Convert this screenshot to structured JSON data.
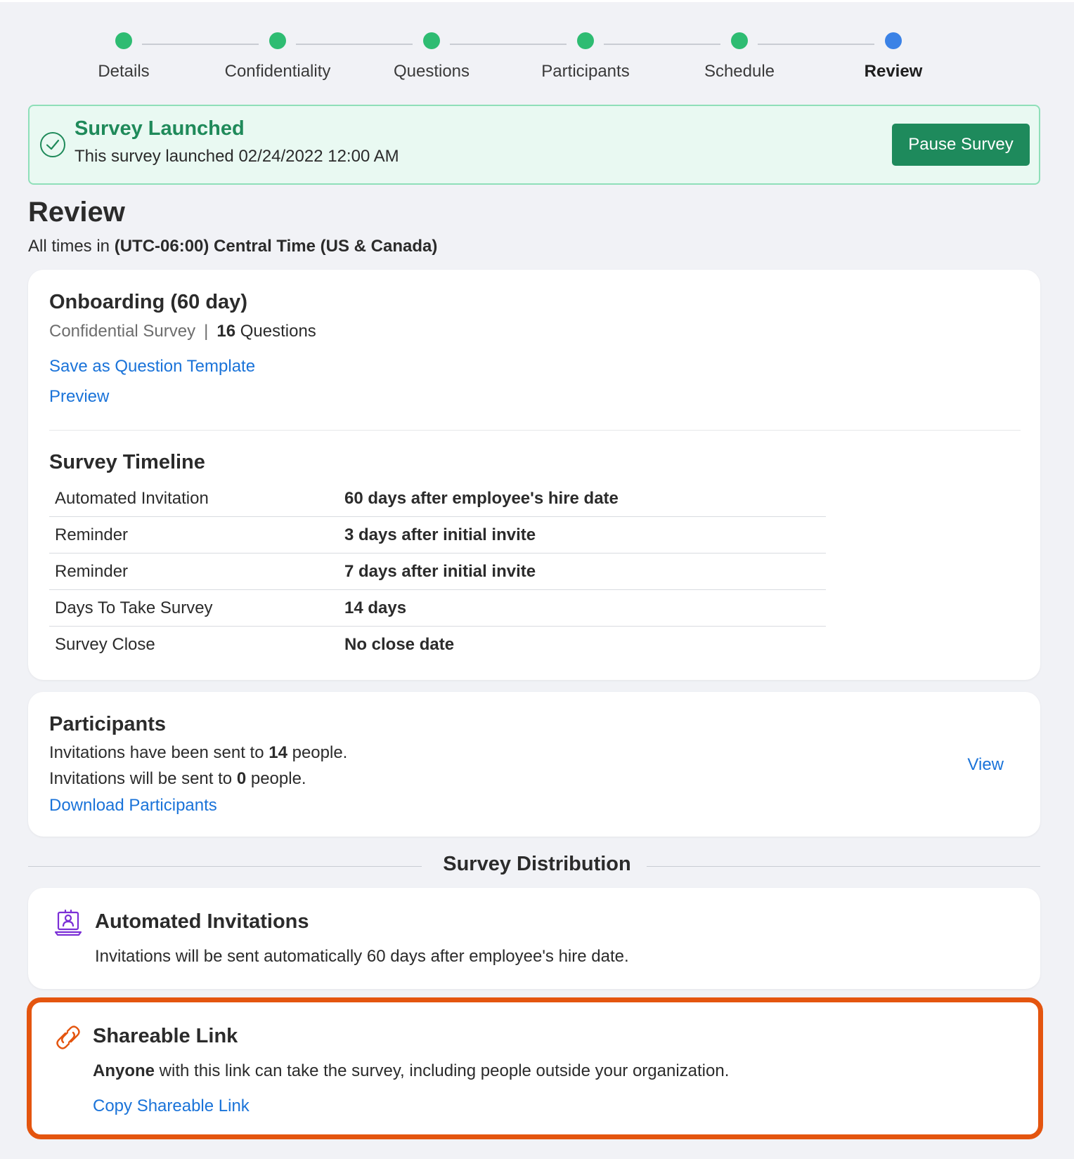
{
  "stepper": {
    "steps": [
      {
        "label": "Details",
        "status": "complete"
      },
      {
        "label": "Confidentiality",
        "status": "complete"
      },
      {
        "label": "Questions",
        "status": "complete"
      },
      {
        "label": "Participants",
        "status": "complete"
      },
      {
        "label": "Schedule",
        "status": "complete"
      },
      {
        "label": "Review",
        "status": "current"
      }
    ],
    "colors": {
      "complete": "#2ebc72",
      "current": "#3b82e6"
    }
  },
  "banner": {
    "title": "Survey Launched",
    "message": "This survey launched 02/24/2022 12:00 AM",
    "button": "Pause Survey",
    "icon": "check-circle-icon"
  },
  "page": {
    "title": "Review",
    "timezone_prefix": "All times in",
    "timezone": "(UTC-06:00) Central Time (US & Canada)"
  },
  "survey": {
    "name": "Onboarding (60 day)",
    "type": "Confidential Survey",
    "separator": "|",
    "question_count": "16",
    "question_word": "Questions",
    "save_template_link": "Save as Question Template",
    "preview_link": "Preview"
  },
  "timeline": {
    "title": "Survey Timeline",
    "rows": [
      {
        "label": "Automated Invitation",
        "value": "60 days after employee's hire date"
      },
      {
        "label": "Reminder",
        "value": "3 days after initial invite"
      },
      {
        "label": "Reminder",
        "value": "7 days after initial invite"
      },
      {
        "label": "Days To Take Survey",
        "value": "14 days"
      },
      {
        "label": "Survey Close",
        "value": "No close date"
      }
    ]
  },
  "participants": {
    "title": "Participants",
    "sent_prefix": "Invitations have been sent to",
    "sent_count": "14",
    "sent_suffix": "people.",
    "pending_prefix": "Invitations will be sent to",
    "pending_count": "0",
    "pending_suffix": "people.",
    "download_link": "Download Participants",
    "view_link": "View"
  },
  "distribution": {
    "title": "Survey Distribution",
    "automated": {
      "title": "Automated Invitations",
      "text": "Invitations will be sent automatically 60 days after employee's hire date.",
      "icon": "automated-invitation-icon"
    },
    "shareable": {
      "title": "Shareable Link",
      "text_bold": "Anyone",
      "text_rest": " with this link can take the survey, including people outside your organization.",
      "copy_link": "Copy Shareable Link",
      "icon": "link-icon",
      "highlight_color": "#e4550f"
    }
  }
}
